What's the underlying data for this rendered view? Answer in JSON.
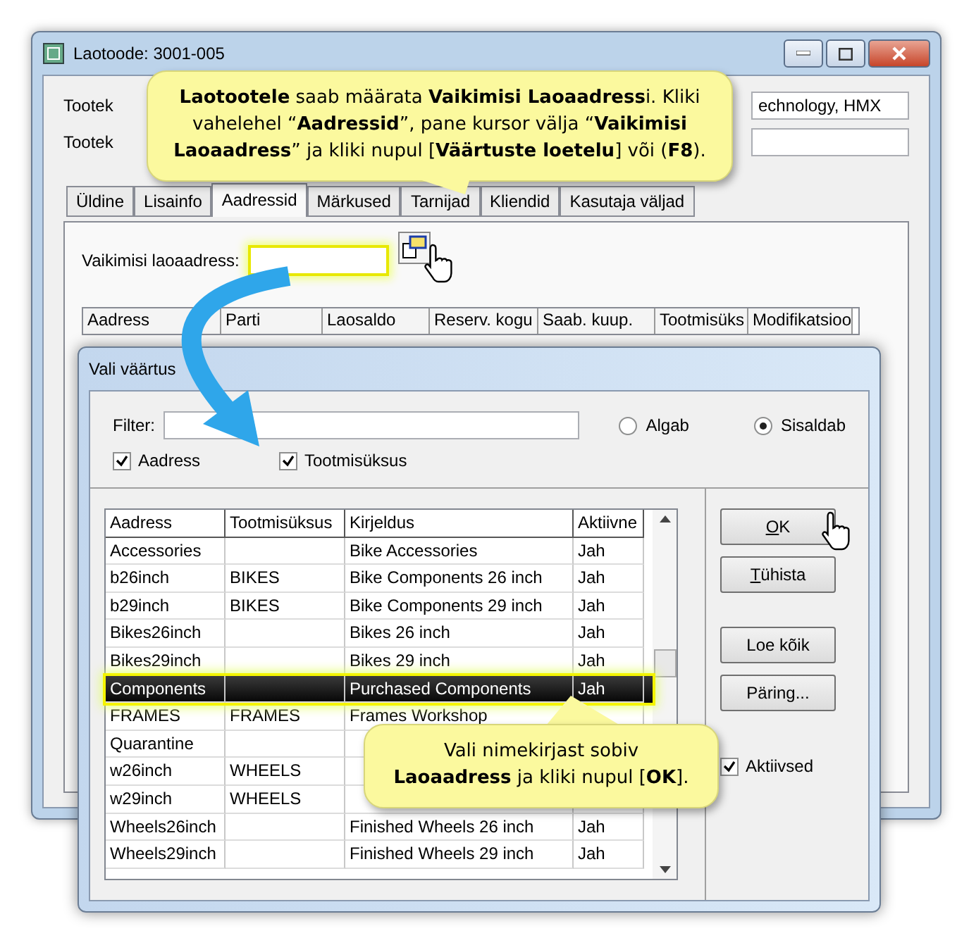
{
  "main_window": {
    "title": "Laotoode: 3001-005",
    "fields": [
      {
        "label": "Tootek",
        "value": "echnology, HMX"
      },
      {
        "label": "Tootek"
      }
    ],
    "tabs": [
      {
        "label": "Üldine",
        "selected": false
      },
      {
        "label": "Lisainfo",
        "selected": false
      },
      {
        "label": "Aadressid",
        "selected": true
      },
      {
        "label": "Märkused",
        "selected": false
      },
      {
        "label": "Tarnijad",
        "selected": false
      },
      {
        "label": "Kliendid",
        "selected": false
      },
      {
        "label": "Kasutaja väljad",
        "selected": false
      }
    ],
    "default_address": {
      "label": "Vaikimisi laoaadress:"
    },
    "grid_columns": [
      "Aadress",
      "Parti",
      "Laosaldo",
      "Reserv. kogu",
      "Saab. kuup.",
      "Tootmisüks",
      "Modifikatsioo"
    ]
  },
  "callout_top": "**Laotootele** saab määrata **Vaikimisi Laoaadress**i. Kliki vahelehel “**Aadressid**”, pane kursor välja “**Vaikimisi Laoaadress**” ja kliki nupul [**Väärtuste loetelu**] või (**F8**).",
  "dialog": {
    "title": "Vali väärtus",
    "filter_label": "Filter:",
    "match_options": [
      {
        "label": "Algab",
        "selected": false
      },
      {
        "label": "Sisaldab",
        "selected": true
      }
    ],
    "search_in": [
      {
        "label": "Aadress",
        "checked": true
      },
      {
        "label": "Tootmisüksus",
        "checked": true
      }
    ],
    "columns": [
      "Aadress",
      "Tootmisüksus",
      "Kirjeldus",
      "Aktiivne"
    ],
    "rows": [
      {
        "cells": [
          "Accessories",
          "",
          "Bike Accessories",
          "Jah"
        ],
        "selected": false
      },
      {
        "cells": [
          "b26inch",
          "BIKES",
          "Bike Components 26 inch",
          "Jah"
        ],
        "selected": false
      },
      {
        "cells": [
          "b29inch",
          "BIKES",
          "Bike Components 29 inch",
          "Jah"
        ],
        "selected": false
      },
      {
        "cells": [
          "Bikes26inch",
          "",
          "Bikes 26 inch",
          "Jah"
        ],
        "selected": false
      },
      {
        "cells": [
          "Bikes29inch",
          "",
          "Bikes 29 inch",
          "Jah"
        ],
        "selected": false
      },
      {
        "cells": [
          "Components",
          "",
          "Purchased Components",
          "Jah"
        ],
        "selected": true
      },
      {
        "cells": [
          "FRAMES",
          "FRAMES",
          "Frames Workshop",
          ""
        ],
        "selected": false
      },
      {
        "cells": [
          "Quarantine",
          "",
          "",
          ""
        ],
        "selected": false
      },
      {
        "cells": [
          "w26inch",
          "WHEELS",
          "",
          ""
        ],
        "selected": false
      },
      {
        "cells": [
          "w29inch",
          "WHEELS",
          "",
          ""
        ],
        "selected": false
      },
      {
        "cells": [
          "Wheels26inch",
          "",
          "Finished Wheels 26 inch",
          "Jah"
        ],
        "selected": false
      },
      {
        "cells": [
          "Wheels29inch",
          "",
          "Finished Wheels 29 inch",
          "Jah"
        ],
        "selected": false
      }
    ],
    "buttons": [
      {
        "label": "OK",
        "mnemonic": true
      },
      {
        "label": "Tühista",
        "mnemonic": true
      },
      {
        "label": "Loe kõik",
        "mnemonic": false
      },
      {
        "label": "Päring...",
        "mnemonic": false
      }
    ],
    "active_only": {
      "label": "Aktiivsed",
      "checked": true
    }
  },
  "callout_bottom": "Vali nimekirjast sobiv **Laoaadress** ja kliki nupul [**OK**]."
}
